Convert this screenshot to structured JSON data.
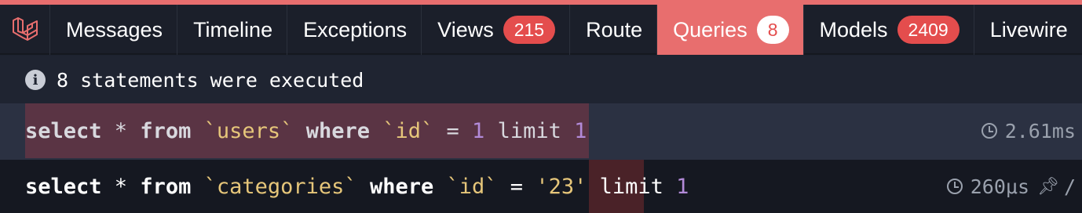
{
  "tabs": [
    {
      "label": "Messages"
    },
    {
      "label": "Timeline"
    },
    {
      "label": "Exceptions"
    },
    {
      "label": "Views",
      "badge": "215"
    },
    {
      "label": "Route"
    },
    {
      "label": "Queries",
      "badge": "8",
      "active": true
    },
    {
      "label": "Models",
      "badge": "2409"
    },
    {
      "label": "Livewire"
    }
  ],
  "info": {
    "text": "8 statements were executed"
  },
  "queries": [
    {
      "tokens": [
        {
          "t": "select",
          "c": "kw"
        },
        {
          "t": " * ",
          "c": "txt"
        },
        {
          "t": "from",
          "c": "kw"
        },
        {
          "t": " ",
          "c": "txt"
        },
        {
          "t": "`users`",
          "c": "str"
        },
        {
          "t": " ",
          "c": "txt"
        },
        {
          "t": "where",
          "c": "kw"
        },
        {
          "t": " ",
          "c": "txt"
        },
        {
          "t": "`id`",
          "c": "str"
        },
        {
          "t": " = ",
          "c": "txt"
        },
        {
          "t": "1",
          "c": "num"
        },
        {
          "t": " limit ",
          "c": "txt"
        },
        {
          "t": "1",
          "c": "num"
        }
      ],
      "duration": "2.61ms"
    },
    {
      "tokens": [
        {
          "t": "select",
          "c": "kw"
        },
        {
          "t": " * ",
          "c": "txt"
        },
        {
          "t": "from",
          "c": "kw"
        },
        {
          "t": " ",
          "c": "txt"
        },
        {
          "t": "`categories`",
          "c": "str"
        },
        {
          "t": " ",
          "c": "txt"
        },
        {
          "t": "where",
          "c": "kw"
        },
        {
          "t": " ",
          "c": "txt"
        },
        {
          "t": "`id`",
          "c": "str"
        },
        {
          "t": " = ",
          "c": "txt"
        },
        {
          "t": "'23'",
          "c": "str"
        },
        {
          "t": " limit ",
          "c": "txt"
        },
        {
          "t": "1",
          "c": "num"
        }
      ],
      "duration": "260μs"
    }
  ],
  "colors": {
    "accent": "#e86e6e",
    "badge": "#e44d4d"
  }
}
